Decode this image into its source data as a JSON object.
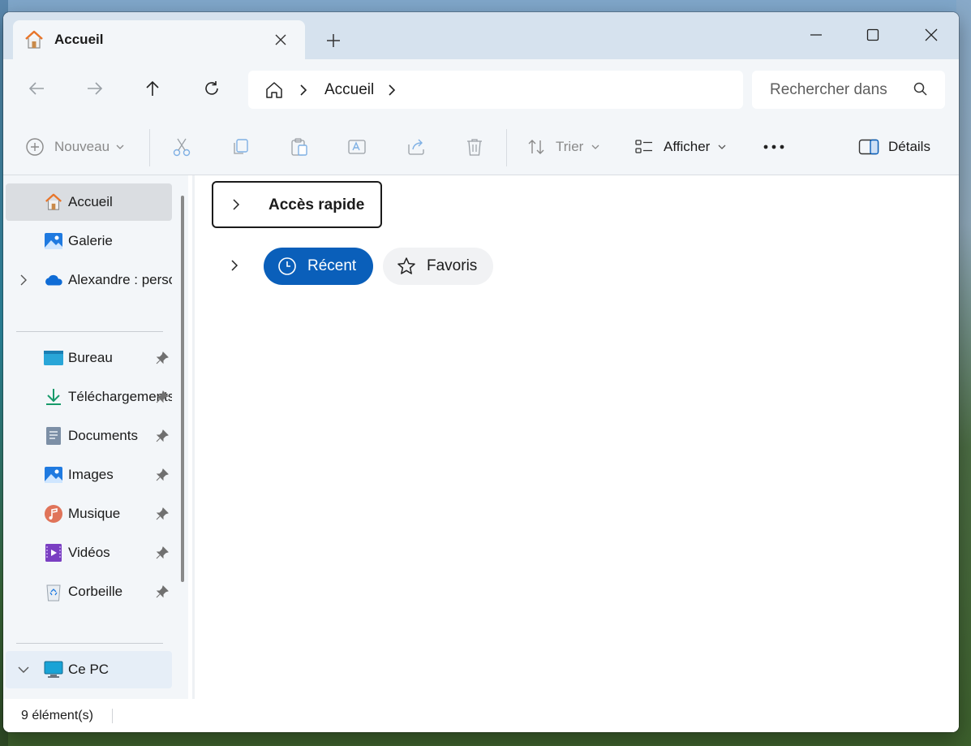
{
  "tab": {
    "title": "Accueil",
    "icon": "home-icon"
  },
  "window_controls": {
    "minimize": "minimize-icon",
    "maximize": "maximize-icon",
    "close": "close-icon"
  },
  "address": {
    "crumbs": [
      "Accueil"
    ]
  },
  "search": {
    "placeholder": "Rechercher dans"
  },
  "toolbar": {
    "new_label": "Nouveau",
    "sort_label": "Trier",
    "view_label": "Afficher",
    "details_label": "Détails",
    "actions": [
      "cut-icon",
      "copy-icon",
      "paste-icon",
      "rename-icon",
      "share-icon",
      "delete-icon"
    ]
  },
  "sidebar": {
    "top": [
      {
        "label": "Accueil",
        "icon": "home-icon"
      },
      {
        "label": "Galerie",
        "icon": "gallery-icon"
      },
      {
        "label": "Alexandre : personnel",
        "icon": "onedrive-icon"
      }
    ],
    "pinned": [
      {
        "label": "Bureau",
        "icon": "desktop-icon"
      },
      {
        "label": "Téléchargements",
        "icon": "download-icon"
      },
      {
        "label": "Documents",
        "icon": "documents-icon"
      },
      {
        "label": "Images",
        "icon": "images-icon"
      },
      {
        "label": "Musique",
        "icon": "music-icon"
      },
      {
        "label": "Vidéos",
        "icon": "videos-icon"
      },
      {
        "label": "Corbeille",
        "icon": "recycle-bin-icon"
      }
    ],
    "pc": {
      "label": "Ce PC",
      "icon": "pc-icon"
    }
  },
  "content": {
    "quick_access": "Accès rapide",
    "pills": {
      "recent": "Récent",
      "favorites": "Favoris"
    }
  },
  "status": {
    "count": "9 élément(s)"
  },
  "colors": {
    "accent": "#0a5fba",
    "titlebar": "#d6e2ee",
    "chrome": "#f3f6f9"
  }
}
